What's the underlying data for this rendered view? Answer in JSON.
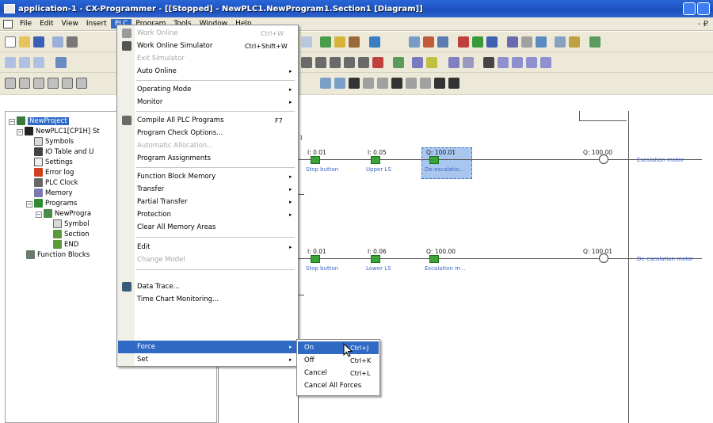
{
  "window": {
    "title": "application-1 - CX-Programmer - [[Stopped] - NewPLC1.NewProgram1.Section1 [Diagram]]"
  },
  "menubar": {
    "items": [
      "File",
      "Edit",
      "View",
      "Insert",
      "PLC",
      "Program",
      "Tools",
      "Window",
      "Help"
    ],
    "active": "PLC",
    "mdi_controls": "- ₽"
  },
  "tree": {
    "items": [
      {
        "label": "NewProject",
        "icon": "project-icon"
      },
      {
        "label": "NewPLC1[CP1H] St",
        "icon": "plc-icon"
      },
      {
        "label": "Symbols",
        "icon": "symbols-icon"
      },
      {
        "label": "IO Table and U",
        "icon": "io-table-icon"
      },
      {
        "label": "Settings",
        "icon": "settings-icon"
      },
      {
        "label": "Error log",
        "icon": "error-log-icon"
      },
      {
        "label": "PLC Clock",
        "icon": "clock-icon"
      },
      {
        "label": "Memory",
        "icon": "memory-icon"
      },
      {
        "label": "Programs",
        "icon": "programs-icon"
      },
      {
        "label": "NewProgra",
        "icon": "program-icon"
      },
      {
        "label": "Symbol",
        "icon": "symbols-icon"
      },
      {
        "label": "Section",
        "icon": "section-icon"
      },
      {
        "label": "END",
        "icon": "end-icon"
      },
      {
        "label": "Function Blocks",
        "icon": "function-blocks-icon"
      }
    ]
  },
  "plc_menu": {
    "items": [
      {
        "label": "Work Online",
        "shortcut": "Ctrl+W",
        "disabled": true
      },
      {
        "label": "Work Online Simulator",
        "shortcut": "Ctrl+Shift+W"
      },
      {
        "label": "Exit Simulator",
        "disabled": true
      },
      {
        "label": "Auto Online",
        "submenu": true
      },
      {
        "separator": true
      },
      {
        "label": "Operating Mode",
        "submenu": true
      },
      {
        "label": "Monitor",
        "submenu": true
      },
      {
        "separator": true
      },
      {
        "label": "Compile All PLC Programs",
        "shortcut": "F7"
      },
      {
        "label": "Program Check Options..."
      },
      {
        "label": "Automatic Allocation...",
        "disabled": true
      },
      {
        "label": "Program Assignments"
      },
      {
        "separator": true
      },
      {
        "label": "Function Block Memory",
        "submenu": true
      },
      {
        "label": "Transfer",
        "submenu": true
      },
      {
        "label": "Partial Transfer",
        "submenu": true
      },
      {
        "label": "Protection",
        "submenu": true
      },
      {
        "label": "Clear All Memory Areas"
      },
      {
        "separator": true
      },
      {
        "label": "Edit",
        "submenu": true
      },
      {
        "label": "Change Model",
        "disabled": true
      },
      {
        "separator": true
      },
      {
        "label": "Data Trace..."
      },
      {
        "label": "Time Chart Monitoring..."
      },
      {
        "label": "Force",
        "submenu": true,
        "highlighted": true
      },
      {
        "label": "Set",
        "submenu": true
      }
    ]
  },
  "force_menu": {
    "items": [
      {
        "label": "On",
        "shortcut": "Ctrl+J",
        "highlighted": true
      },
      {
        "label": "Off",
        "shortcut": "Ctrl+K"
      },
      {
        "label": "Cancel",
        "shortcut": "Ctrl+L"
      },
      {
        "label": "Cancel All Forces"
      }
    ]
  },
  "ladder": {
    "rung1": {
      "contacts": [
        {
          "addr": "I: 0.01",
          "comment": "Stop button"
        },
        {
          "addr": "I: 0.05",
          "comment": "Upper LS"
        },
        {
          "addr": "Q: 100.01",
          "comment": "De-escalatio..."
        }
      ],
      "coil": {
        "addr": "Q: 100.00",
        "comment": "Escalation motor"
      }
    },
    "rung2": {
      "contacts": [
        {
          "addr": "I: 0.01",
          "comment": "Stop button"
        },
        {
          "addr": "I: 0.06",
          "comment": "Lower LS"
        },
        {
          "addr": "Q: 100.00",
          "comment": "Escalation m..."
        }
      ],
      "coil": {
        "addr": "Q: 100.01",
        "comment": "De-escalation motor"
      }
    }
  },
  "colors": {
    "title_bar": "#1c4fbd",
    "menu_highlight": "#316ac5",
    "contact_green": "#3aa33a",
    "comment_blue": "#3b66c8"
  }
}
